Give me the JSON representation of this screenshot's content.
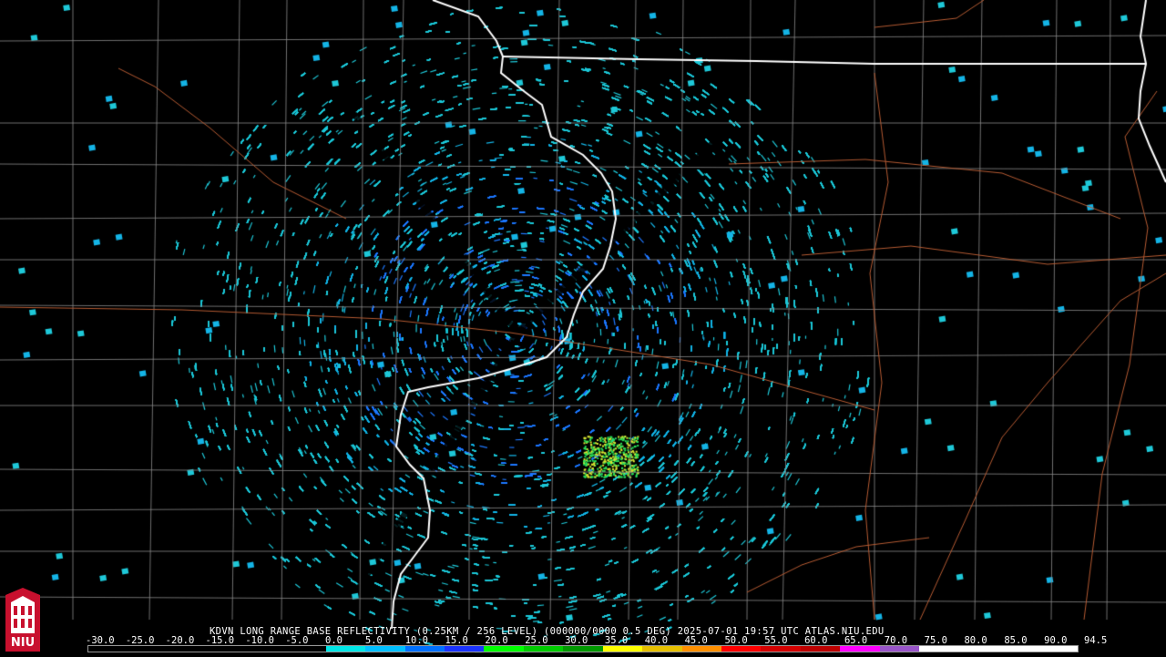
{
  "header": {
    "title": "KDVN LONG RANGE BASE REFLECTIVITY (0.25KM / 256 LEVEL) (000000/0000 0.5 DEG) 2025-07-01 19:57 UTC  ATLAS.NIU.EDU"
  },
  "scale": {
    "labels": [
      "-30.0",
      "-25.0",
      "-20.0",
      "-15.0",
      "-10.0",
      "-5.0",
      "0.0",
      "5.0",
      "10.0",
      "15.0",
      "20.0",
      "25.0",
      "30.0",
      "35.0",
      "40.0",
      "45.0",
      "50.0",
      "55.0",
      "60.0",
      "65.0",
      "70.0",
      "75.0",
      "80.0",
      "85.0",
      "90.0",
      "94.5"
    ],
    "colors": [
      "#000000",
      "#000000",
      "#000000",
      "#000000",
      "#000000",
      "#000000",
      "#00e6e6",
      "#00bfff",
      "#0070ff",
      "#1a33ff",
      "#00ff00",
      "#00cc00",
      "#009900",
      "#ffff00",
      "#e6c000",
      "#ff9000",
      "#ff0000",
      "#d40000",
      "#bd0000",
      "#ff00ff",
      "#9955c9",
      "#ffffff",
      "#ffffff",
      "#ffffff",
      "#ffffff"
    ]
  },
  "logo": {
    "text": "NIU",
    "color": "#c8102e"
  },
  "map": {
    "radar_site": "KDVN",
    "echo_colors": [
      "#1ec8d8",
      "#14b4e6",
      "#1e78ff",
      "#2a50f0",
      "#28e05a",
      "#d8e632"
    ],
    "state_border_color": "#ffffff",
    "county_line_color": "#8a8a8a",
    "road_color": "#b45a32"
  }
}
